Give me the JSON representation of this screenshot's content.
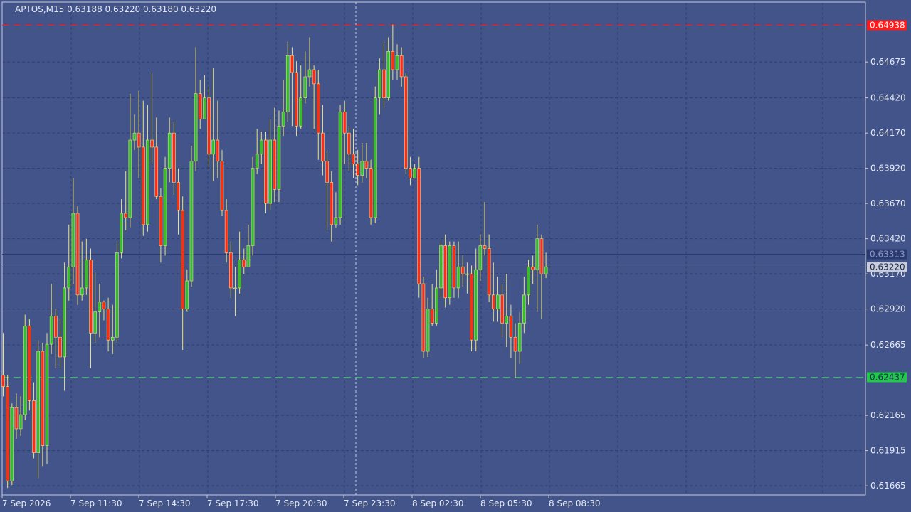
{
  "header": {
    "text": "APTOS,M15  0.63188 0.63220 0.63180 0.63220"
  },
  "colors": {
    "background": "#42548a",
    "grid": "#2f3f6e",
    "bull_body": "#2fbf2f",
    "bear_body": "#ff2a1a",
    "wick": "#e8e27a",
    "resistance": "#ff1a1a",
    "support": "#22c84a",
    "current_price_tag": "#c8ccd8"
  },
  "price_tags": {
    "resistance": {
      "value": "0.64938"
    },
    "ask": {
      "value": "0.63313"
    },
    "current": {
      "value": "0.63220"
    },
    "support": {
      "value": "0.62437"
    }
  },
  "chart_data": {
    "type": "candlestick",
    "symbol": "APTOS",
    "timeframe": "M15",
    "y_ticks": [
      "0.64675",
      "0.64420",
      "0.64170",
      "0.63920",
      "0.63670",
      "0.63420",
      "0.63170",
      "0.62920",
      "0.62665",
      "0.62165",
      "0.61915",
      "0.61665"
    ],
    "x_ticks": [
      "7 Sep 2026",
      "7 Sep 11:30",
      "7 Sep 14:30",
      "7 Sep 17:30",
      "7 Sep 20:30",
      "7 Sep 23:30",
      "8 Sep 02:30",
      "8 Sep 05:30",
      "8 Sep 08:30"
    ],
    "ylim": [
      0.616,
      0.651
    ],
    "resistance_level": 0.64938,
    "support_level": 0.62437,
    "ask_level": 0.63313,
    "current_price": 0.6322,
    "candles": [
      [
        0.6245,
        0.6237,
        0.6275,
        0.623
      ],
      [
        0.6237,
        0.617,
        0.6245,
        0.6165
      ],
      [
        0.617,
        0.6222,
        0.6225,
        0.6167
      ],
      [
        0.6222,
        0.6207,
        0.6232,
        0.62
      ],
      [
        0.6207,
        0.6217,
        0.623,
        0.6202
      ],
      [
        0.6217,
        0.628,
        0.6288,
        0.6213
      ],
      [
        0.628,
        0.6227,
        0.6285,
        0.622
      ],
      [
        0.6227,
        0.619,
        0.624,
        0.6186
      ],
      [
        0.619,
        0.6262,
        0.627,
        0.6172
      ],
      [
        0.6262,
        0.6195,
        0.6268,
        0.618
      ],
      [
        0.6195,
        0.6267,
        0.6275,
        0.6182
      ],
      [
        0.6267,
        0.6287,
        0.631,
        0.626
      ],
      [
        0.6287,
        0.6272,
        0.6292,
        0.625
      ],
      [
        0.6272,
        0.6258,
        0.6285,
        0.625
      ],
      [
        0.6258,
        0.6307,
        0.6325,
        0.6234
      ],
      [
        0.6307,
        0.6322,
        0.6352,
        0.6298
      ],
      [
        0.6322,
        0.636,
        0.6385,
        0.631
      ],
      [
        0.636,
        0.6302,
        0.6365,
        0.6295
      ],
      [
        0.6302,
        0.6307,
        0.634,
        0.6298
      ],
      [
        0.6307,
        0.6327,
        0.6342,
        0.6302
      ],
      [
        0.6327,
        0.6275,
        0.6335,
        0.625
      ],
      [
        0.6275,
        0.629,
        0.6318,
        0.6268
      ],
      [
        0.629,
        0.6297,
        0.631,
        0.6272
      ],
      [
        0.6297,
        0.6292,
        0.6298,
        0.6284
      ],
      [
        0.6292,
        0.627,
        0.63,
        0.6262
      ],
      [
        0.627,
        0.6272,
        0.6295,
        0.626
      ],
      [
        0.6272,
        0.6332,
        0.634,
        0.6268
      ],
      [
        0.6332,
        0.636,
        0.637,
        0.6328
      ],
      [
        0.636,
        0.6357,
        0.639,
        0.6348
      ],
      [
        0.6357,
        0.6412,
        0.6445,
        0.635
      ],
      [
        0.6412,
        0.6417,
        0.643,
        0.6405
      ],
      [
        0.6417,
        0.6407,
        0.6447,
        0.6385
      ],
      [
        0.6407,
        0.6352,
        0.644,
        0.6344
      ],
      [
        0.6352,
        0.6412,
        0.6437,
        0.6347
      ],
      [
        0.6412,
        0.6407,
        0.646,
        0.6395
      ],
      [
        0.6407,
        0.6372,
        0.6428,
        0.637
      ],
      [
        0.6372,
        0.6337,
        0.6378,
        0.6325
      ],
      [
        0.6337,
        0.6392,
        0.64,
        0.633
      ],
      [
        0.6392,
        0.6417,
        0.6428,
        0.6382
      ],
      [
        0.6417,
        0.6382,
        0.6425,
        0.6373
      ],
      [
        0.6382,
        0.6362,
        0.6392,
        0.6345
      ],
      [
        0.6362,
        0.6292,
        0.6372,
        0.6263
      ],
      [
        0.6292,
        0.6312,
        0.632,
        0.629
      ],
      [
        0.6312,
        0.6397,
        0.6408,
        0.6308
      ],
      [
        0.6397,
        0.6445,
        0.6478,
        0.639
      ],
      [
        0.6445,
        0.6427,
        0.6455,
        0.642
      ],
      [
        0.6427,
        0.6442,
        0.6458,
        0.6435
      ],
      [
        0.6442,
        0.6402,
        0.645,
        0.6393
      ],
      [
        0.6402,
        0.6412,
        0.6463,
        0.6383
      ],
      [
        0.6412,
        0.6397,
        0.644,
        0.6385
      ],
      [
        0.6397,
        0.6362,
        0.6405,
        0.6358
      ],
      [
        0.6362,
        0.6332,
        0.637,
        0.6325
      ],
      [
        0.6332,
        0.6307,
        0.634,
        0.63
      ],
      [
        0.6307,
        0.6307,
        0.6322,
        0.6287
      ],
      [
        0.6307,
        0.6327,
        0.6347,
        0.6303
      ],
      [
        0.6327,
        0.6322,
        0.6335,
        0.6317
      ],
      [
        0.6322,
        0.6337,
        0.6352,
        0.6328
      ],
      [
        0.6337,
        0.6392,
        0.64,
        0.633
      ],
      [
        0.6392,
        0.6402,
        0.642,
        0.6388
      ],
      [
        0.6402,
        0.6412,
        0.6418,
        0.6395
      ],
      [
        0.6412,
        0.6367,
        0.6418,
        0.636
      ],
      [
        0.6367,
        0.6412,
        0.6427,
        0.6362
      ],
      [
        0.6412,
        0.6377,
        0.6435,
        0.6368
      ],
      [
        0.6377,
        0.6422,
        0.6433,
        0.6368
      ],
      [
        0.6422,
        0.6432,
        0.6455,
        0.6415
      ],
      [
        0.6432,
        0.6472,
        0.6482,
        0.6425
      ],
      [
        0.6472,
        0.646,
        0.6478,
        0.6422
      ],
      [
        0.646,
        0.6422,
        0.6468,
        0.6415
      ],
      [
        0.6422,
        0.6442,
        0.6465,
        0.642
      ],
      [
        0.6442,
        0.6457,
        0.6475,
        0.6438
      ],
      [
        0.6457,
        0.6462,
        0.6485,
        0.645
      ],
      [
        0.6462,
        0.6452,
        0.6465,
        0.642
      ],
      [
        0.6452,
        0.6417,
        0.6462,
        0.6398
      ],
      [
        0.6417,
        0.6397,
        0.6437,
        0.6387
      ],
      [
        0.6397,
        0.6382,
        0.6405,
        0.6348
      ],
      [
        0.6382,
        0.6352,
        0.639,
        0.634
      ],
      [
        0.6352,
        0.6357,
        0.6375,
        0.635
      ],
      [
        0.6357,
        0.6432,
        0.6437,
        0.6352
      ],
      [
        0.6432,
        0.6417,
        0.644,
        0.6395
      ],
      [
        0.6417,
        0.6402,
        0.6422,
        0.639
      ],
      [
        0.6402,
        0.6395,
        0.642,
        0.6385
      ],
      [
        0.6395,
        0.6387,
        0.6405,
        0.638
      ],
      [
        0.6387,
        0.6397,
        0.641,
        0.6382
      ],
      [
        0.6397,
        0.6392,
        0.641,
        0.6385
      ],
      [
        0.6392,
        0.6357,
        0.6398,
        0.6352
      ],
      [
        0.6357,
        0.6442,
        0.645,
        0.6353
      ],
      [
        0.6442,
        0.6462,
        0.647,
        0.643
      ],
      [
        0.6462,
        0.6442,
        0.6482,
        0.6435
      ],
      [
        0.6442,
        0.6475,
        0.6485,
        0.644
      ],
      [
        0.6475,
        0.6462,
        0.6494,
        0.6455
      ],
      [
        0.6462,
        0.6472,
        0.648,
        0.6455
      ],
      [
        0.6472,
        0.6457,
        0.6478,
        0.645
      ],
      [
        0.6457,
        0.6392,
        0.646,
        0.6388
      ],
      [
        0.6392,
        0.6385,
        0.64,
        0.638
      ],
      [
        0.6385,
        0.6392,
        0.6395,
        0.6388
      ],
      [
        0.6392,
        0.631,
        0.64,
        0.63
      ],
      [
        0.631,
        0.6262,
        0.6315,
        0.6257
      ],
      [
        0.6262,
        0.6292,
        0.63,
        0.6258
      ],
      [
        0.6292,
        0.6282,
        0.631,
        0.628
      ],
      [
        0.6282,
        0.6307,
        0.632,
        0.628
      ],
      [
        0.6307,
        0.6337,
        0.634,
        0.63
      ],
      [
        0.6337,
        0.63,
        0.6345,
        0.6293
      ],
      [
        0.63,
        0.6337,
        0.634,
        0.6295
      ],
      [
        0.6337,
        0.6307,
        0.634,
        0.63
      ],
      [
        0.6307,
        0.6322,
        0.634,
        0.63
      ],
      [
        0.6322,
        0.6317,
        0.633,
        0.6308
      ],
      [
        0.6317,
        0.6317,
        0.6325,
        0.6303
      ],
      [
        0.6317,
        0.627,
        0.6323,
        0.6262
      ],
      [
        0.627,
        0.632,
        0.6335,
        0.6262
      ],
      [
        0.632,
        0.6337,
        0.6345,
        0.6312
      ],
      [
        0.6337,
        0.6335,
        0.6368,
        0.633
      ],
      [
        0.6335,
        0.6302,
        0.6345,
        0.6297
      ],
      [
        0.6302,
        0.6292,
        0.6325,
        0.6283
      ],
      [
        0.6292,
        0.6302,
        0.6315,
        0.6283
      ],
      [
        0.6302,
        0.6282,
        0.631,
        0.6272
      ],
      [
        0.6282,
        0.6287,
        0.6317,
        0.6265
      ],
      [
        0.6287,
        0.6272,
        0.6295,
        0.6257
      ],
      [
        0.6272,
        0.6262,
        0.6282,
        0.6243
      ],
      [
        0.6262,
        0.6282,
        0.629,
        0.6253
      ],
      [
        0.6282,
        0.6302,
        0.6315,
        0.6275
      ],
      [
        0.6302,
        0.6322,
        0.6327,
        0.6295
      ],
      [
        0.6322,
        0.632,
        0.633,
        0.631
      ],
      [
        0.632,
        0.6342,
        0.6352,
        0.629
      ],
      [
        0.6342,
        0.6317,
        0.6345,
        0.6285
      ],
      [
        0.6317,
        0.6322,
        0.6332,
        0.6314
      ]
    ]
  }
}
